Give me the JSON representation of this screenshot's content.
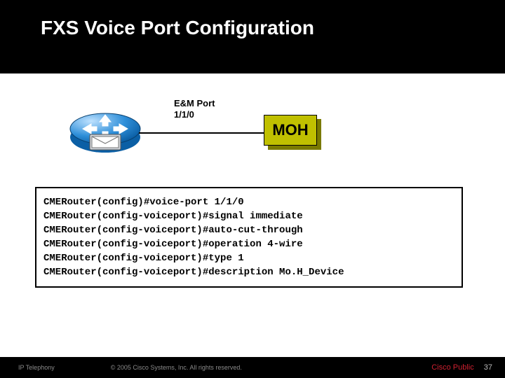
{
  "title": "FXS Voice Port Configuration",
  "diagram": {
    "port_label_line1": "E&M Port",
    "port_label_line2": "1/1/0",
    "moh_label": "MOH"
  },
  "config_lines": [
    "CMERouter(config)#voice-port 1/1/0",
    "CMERouter(config-voiceport)#signal immediate",
    "CMERouter(config-voiceport)#auto-cut-through",
    "CMERouter(config-voiceport)#operation 4-wire",
    "CMERouter(config-voiceport)#type 1",
    "CMERouter(config-voiceport)#description Mo.H_Device"
  ],
  "footer": {
    "left": "IP Telephony",
    "mid": "© 2005 Cisco Systems, Inc. All rights reserved.",
    "right": "Cisco Public",
    "num": "37"
  }
}
